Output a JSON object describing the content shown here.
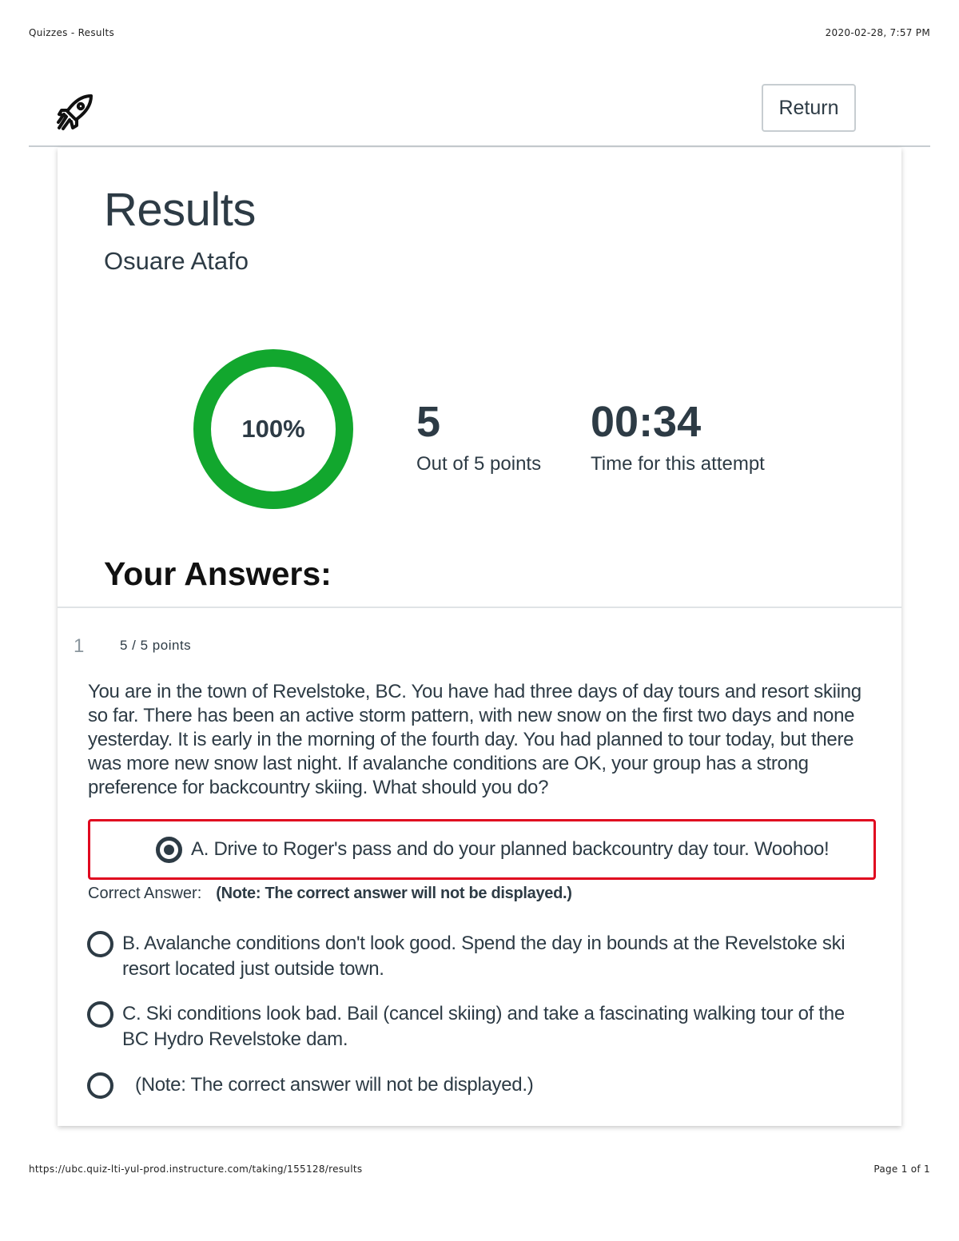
{
  "print_header": {
    "title": "Quizzes - Results",
    "datetime": "2020-02-28, 7:57 PM"
  },
  "print_footer": {
    "url": "https://ubc.quiz-lti-yul-prod.instructure.com/taking/155128/results",
    "page": "Page 1 of 1"
  },
  "header": {
    "logo_icon": "rocket-icon",
    "return_label": "Return"
  },
  "results": {
    "title": "Results",
    "student_name": "Osuare Atafo",
    "score_percent_label": "100%",
    "score_fraction": 1.0,
    "ring_color": "#12a72e",
    "points_value": "5",
    "points_label": "Out of 5 points",
    "time_value": "00:34",
    "time_label": "Time for this attempt"
  },
  "answers_heading": "Your Answers:",
  "question": {
    "number": "1",
    "points": "5 / 5 points",
    "text": "You are in the town of Revelstoke, BC. You have had three days of day tours and resort skiing so far. There has been an active storm pattern, with new snow on the first two days and none yesterday. It is early in the morning of the fourth day. You had planned to tour today, but there was more new snow last night. If avalanche conditions are OK, your group has a strong preference for backcountry skiing. What should you do?",
    "selected_answer": "A. Drive to Roger's pass and do your planned backcountry day tour. Woohoo!",
    "correct_answer_label": "Correct Answer:",
    "correct_answer_note": "(Note: The correct answer will not be displayed.)",
    "option_b": "B. Avalanche conditions don't look good. Spend the day in bounds at the Revelstoke ski resort located just outside town.",
    "option_c": "C. Ski conditions look bad.  Bail (cancel skiing) and take a fascinating walking tour of the BC Hydro Revelstoke dam.",
    "option_d": "(Note: The correct answer will not be displayed.)",
    "selected_border_color": "#e0061f"
  }
}
